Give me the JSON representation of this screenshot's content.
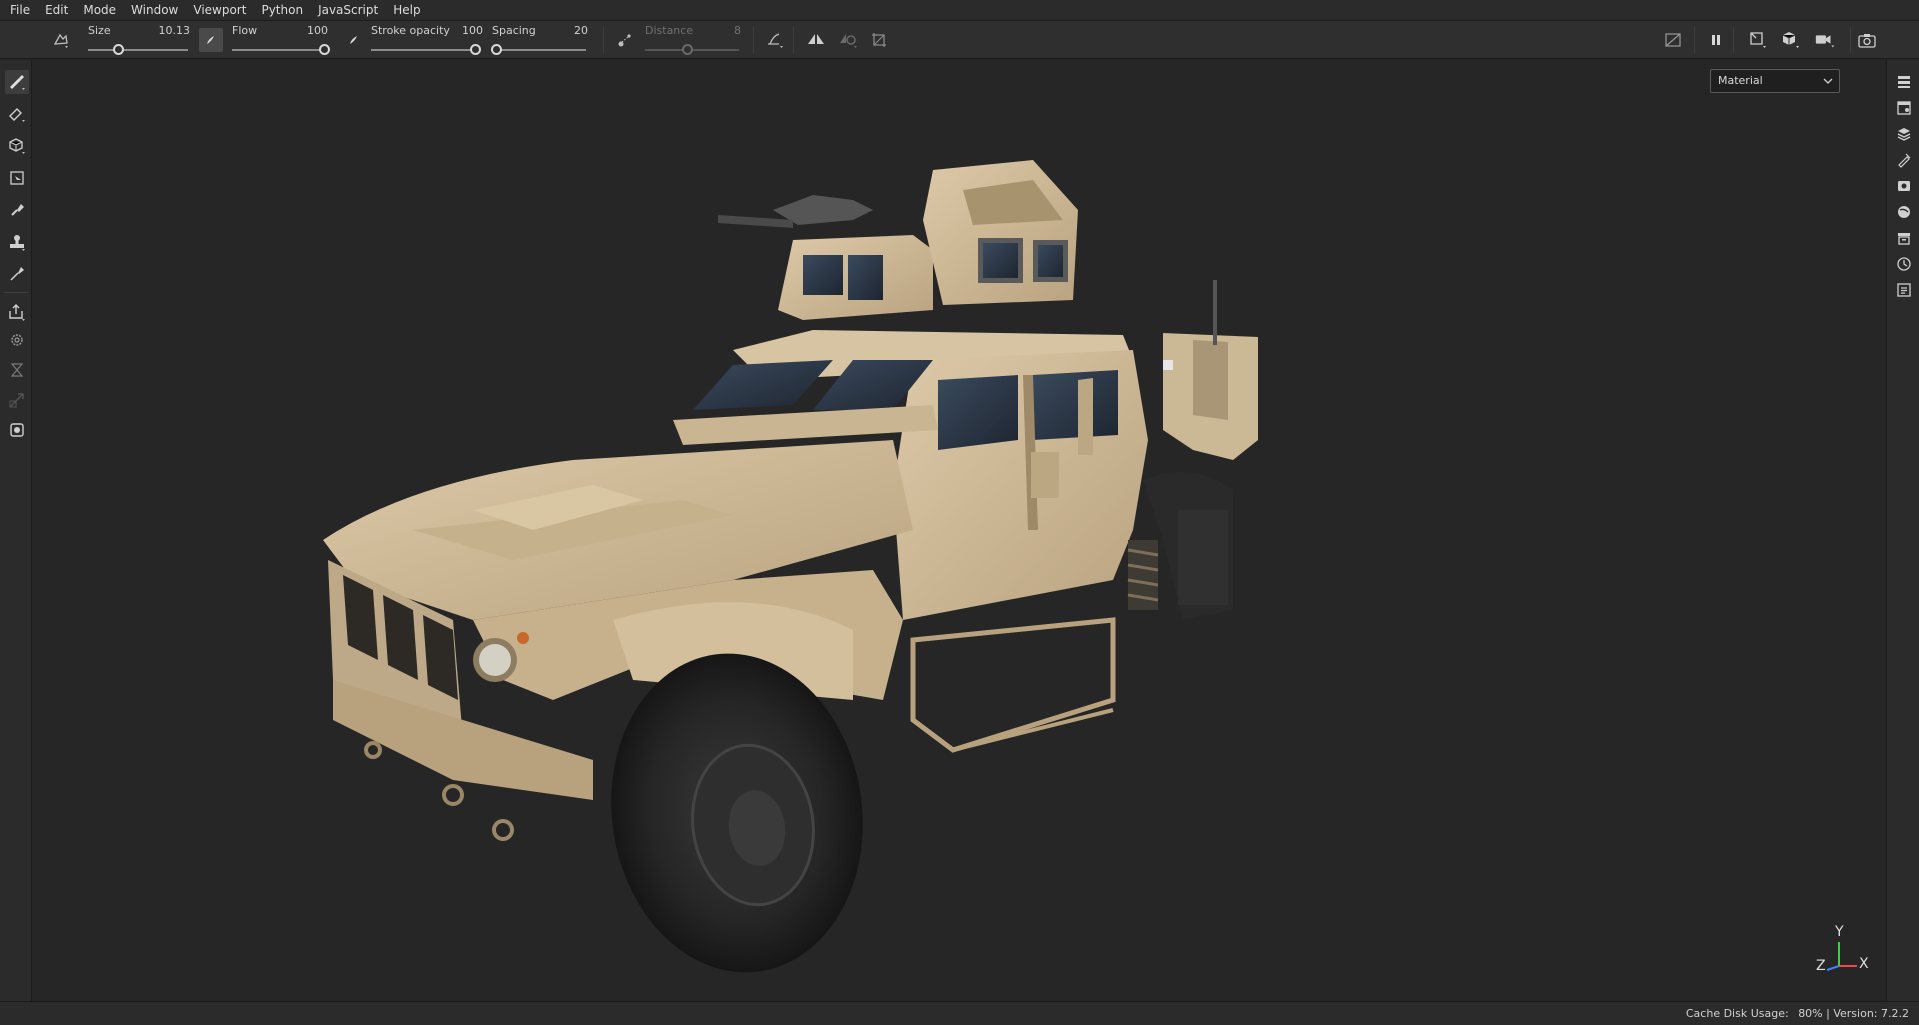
{
  "menu": [
    "File",
    "Edit",
    "Mode",
    "Window",
    "Viewport",
    "Python",
    "JavaScript",
    "Help"
  ],
  "toolbar": {
    "size": {
      "label": "Size",
      "value": "10.13",
      "fraction": 0.3
    },
    "flow": {
      "label": "Flow",
      "value": "100",
      "fraction": 1.0
    },
    "stroke_opacity": {
      "label": "Stroke opacity",
      "value": "100",
      "fraction": 1.0
    },
    "spacing": {
      "label": "Spacing",
      "value": "20",
      "fraction": 0.05
    },
    "distance": {
      "label": "Distance",
      "value": "8",
      "fraction": 0.45,
      "disabled": true
    }
  },
  "left_tools": [
    "paint-brush-icon",
    "eraser-icon",
    "projection-icon",
    "polygon-fill-icon",
    "smudge-icon",
    "clone-stamp-icon",
    "color-picker-icon",
    "export-icon",
    "settings-icon",
    "bake-icon",
    "transform-icon",
    "viewer-icon"
  ],
  "right_panels": [
    "layers-panel-icon",
    "texture-set-icon",
    "layer-stack-icon",
    "properties-icon",
    "display-settings-icon",
    "shader-settings-icon",
    "assets-icon",
    "history-icon",
    "log-icon"
  ],
  "viewport": {
    "channel_select": "Material",
    "axis_labels": {
      "x": "X",
      "y": "Y",
      "z": "Z"
    }
  },
  "status": {
    "cache_label": "Cache Disk Usage:",
    "cache_value": "80%",
    "version": "Version: 7.2.2"
  },
  "colors": {
    "accent": "#d8d8d8",
    "viewport_bg": "#262626",
    "axis_x": "#ff4040",
    "axis_y": "#40d040",
    "axis_z": "#4080ff"
  }
}
